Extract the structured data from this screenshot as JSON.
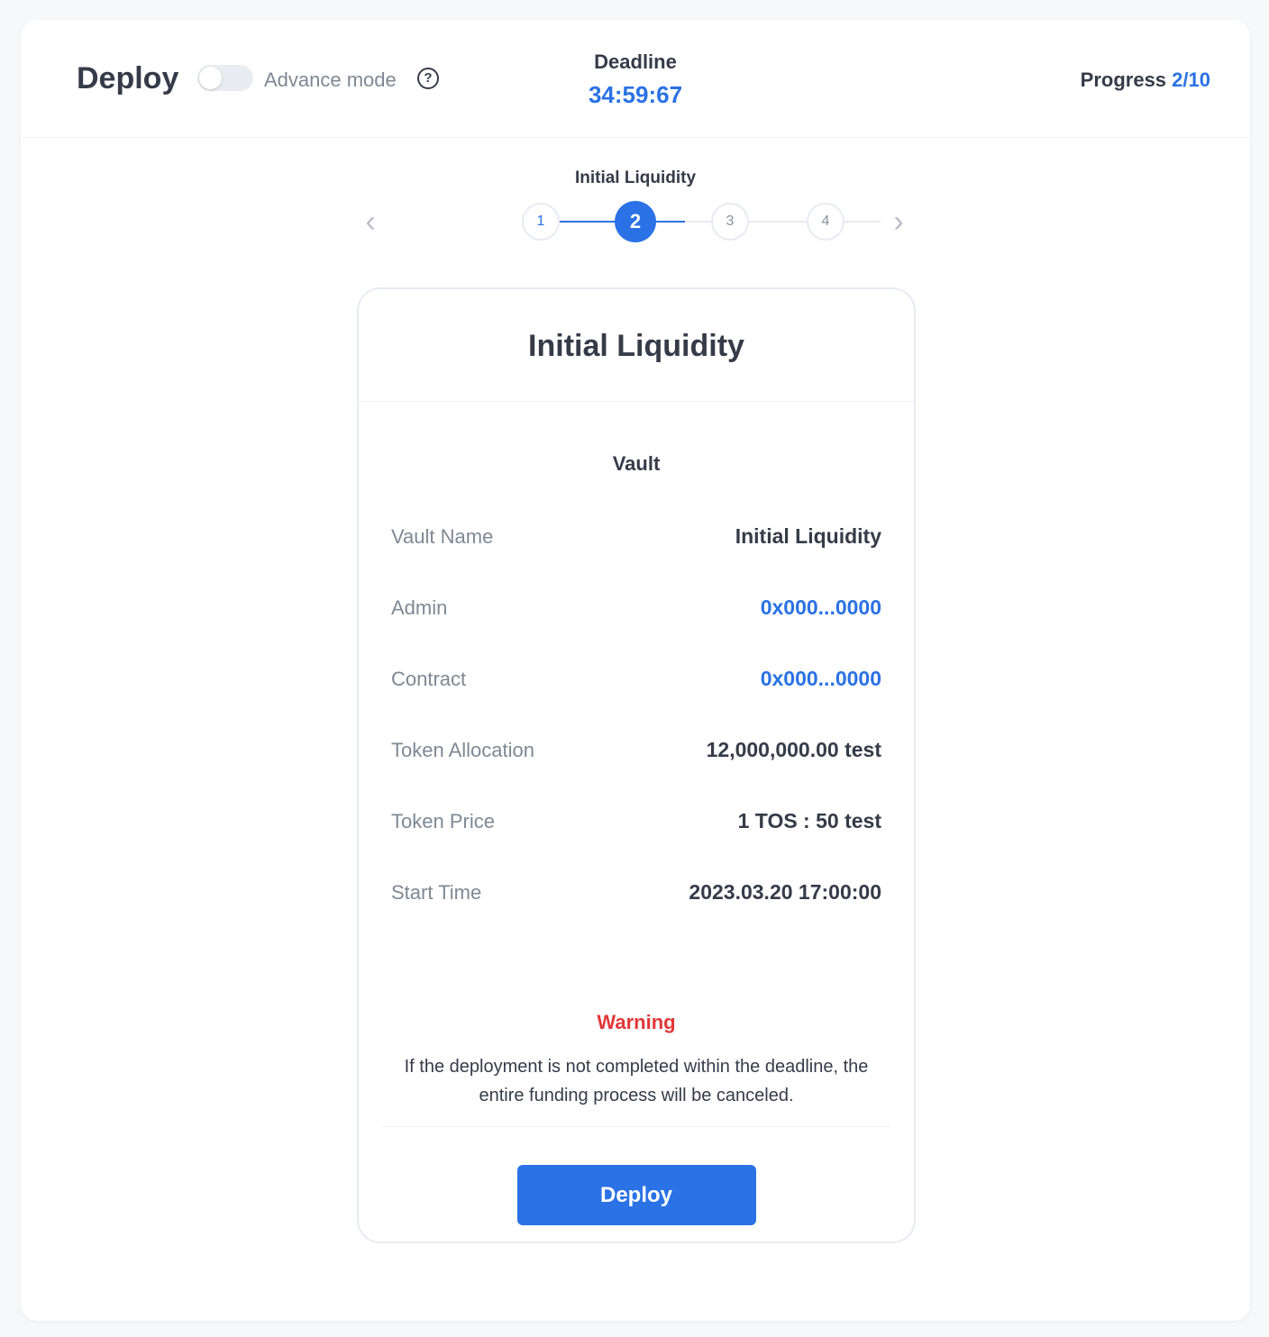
{
  "header": {
    "title": "Deploy",
    "advance_mode_label": "Advance mode",
    "advance_mode_enabled": false,
    "help_icon": "question-circle-icon",
    "deadline_label": "Deadline",
    "deadline_value": "34:59:67",
    "progress_label": "Progress",
    "progress_value": "2/10"
  },
  "stepper": {
    "title": "Initial Liquidity",
    "steps": [
      "1",
      "2",
      "3",
      "4"
    ],
    "current_step": 2,
    "prev_icon": "chevron-left-icon",
    "next_icon": "chevron-right-icon"
  },
  "card": {
    "title": "Initial Liquidity",
    "section_title": "Vault",
    "rows": [
      {
        "label": "Vault Name",
        "value": "Initial Liquidity"
      },
      {
        "label": "Admin",
        "value": "0x000...0000"
      },
      {
        "label": "Contract",
        "value": "0x000...0000"
      },
      {
        "label": "Token Allocation",
        "value": "12,000,000.00 test"
      },
      {
        "label": "Token Price",
        "value": "1 TOS : 50 test"
      },
      {
        "label": "Start Time",
        "value": "2023.03.20 17:00:00"
      }
    ],
    "warning_title": "Warning",
    "warning_text": "If the deployment is not completed within the deadline, the entire funding process will be canceled.",
    "deploy_label": "Deploy"
  },
  "colors": {
    "accent": "#2a72e5",
    "warning": "#e23738",
    "text": "#353c48",
    "muted": "#7e8993"
  }
}
